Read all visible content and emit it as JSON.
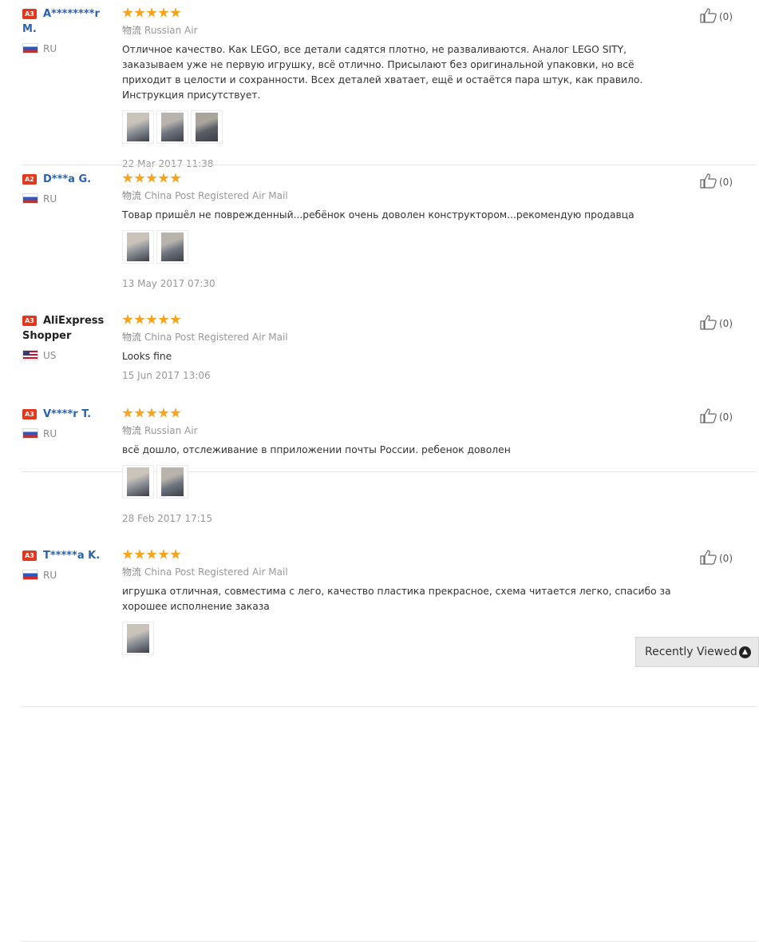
{
  "reviews": [
    {
      "level": "A3",
      "name_lines": [
        "A********r",
        "M."
      ],
      "name_color": "blue",
      "country": "RU",
      "flag": "ru",
      "stars": 5,
      "shipping_icon": "物流",
      "shipping": "Russian Air",
      "text": "Отличное качество. Как LEGO, все детали садятся плотно, не разваливаются. Аналог LEGO SITY, заказываем уже не первую игрушку, всё отлично. Присылают без оригинальной упаковки, но всё приходит в целости и сохранности. Всех деталей хватает, ещё и остаётся пара штук, как правило. Инструкция присутствует.",
      "photos": 3,
      "date": "22 Mar 2017 11:38",
      "useful": "(0)"
    },
    {
      "level": "A2",
      "name_lines": [
        "D***a G."
      ],
      "name_color": "blue",
      "country": "RU",
      "flag": "ru",
      "stars": 5,
      "shipping_icon": "物流",
      "shipping": "China Post Registered Air Mail",
      "text": "Товар пришёл не поврежденный...ребёнок очень доволен конструктором...рекомендую продавца",
      "photos": 2,
      "date": "13 May 2017 07:30",
      "useful": "(0)"
    },
    {
      "level": "A3",
      "name_lines": [
        "AliExpress",
        "Shopper"
      ],
      "name_color": "black",
      "country": "US",
      "flag": "us",
      "stars": 5,
      "shipping_icon": "物流",
      "shipping": "China Post Registered Air Mail",
      "text": "Looks fine",
      "photos": 0,
      "date": "15 Jun 2017 13:06",
      "useful": "(0)"
    },
    {
      "level": "A3",
      "name_lines": [
        "V****r T."
      ],
      "name_color": "blue",
      "country": "RU",
      "flag": "ru",
      "stars": 5,
      "shipping_icon": "物流",
      "shipping": "Russian Air",
      "text": "всё дошло, отслеживание в пприложении почты России. ребенок доволен",
      "photos": 2,
      "date": "28 Feb 2017 17:15",
      "useful": "(0)"
    },
    {
      "level": "A3",
      "name_lines": [
        "T*****a K."
      ],
      "name_color": "blue",
      "country": "RU",
      "flag": "ru",
      "stars": 5,
      "shipping_icon": "物流",
      "shipping": "China Post Registered Air Mail",
      "text": "игрушка отличная, совместима с лего, качество пластика прекрасное, схема читается легко, спасибо за хорошее исполнение заказа",
      "photos": 1,
      "date": "",
      "useful": "(0)"
    }
  ],
  "recently_viewed": {
    "label": "Recently Viewed"
  },
  "colors": {
    "star": "#f7a31c",
    "username": "#2a62b0",
    "level_badge": "#e3371e"
  }
}
